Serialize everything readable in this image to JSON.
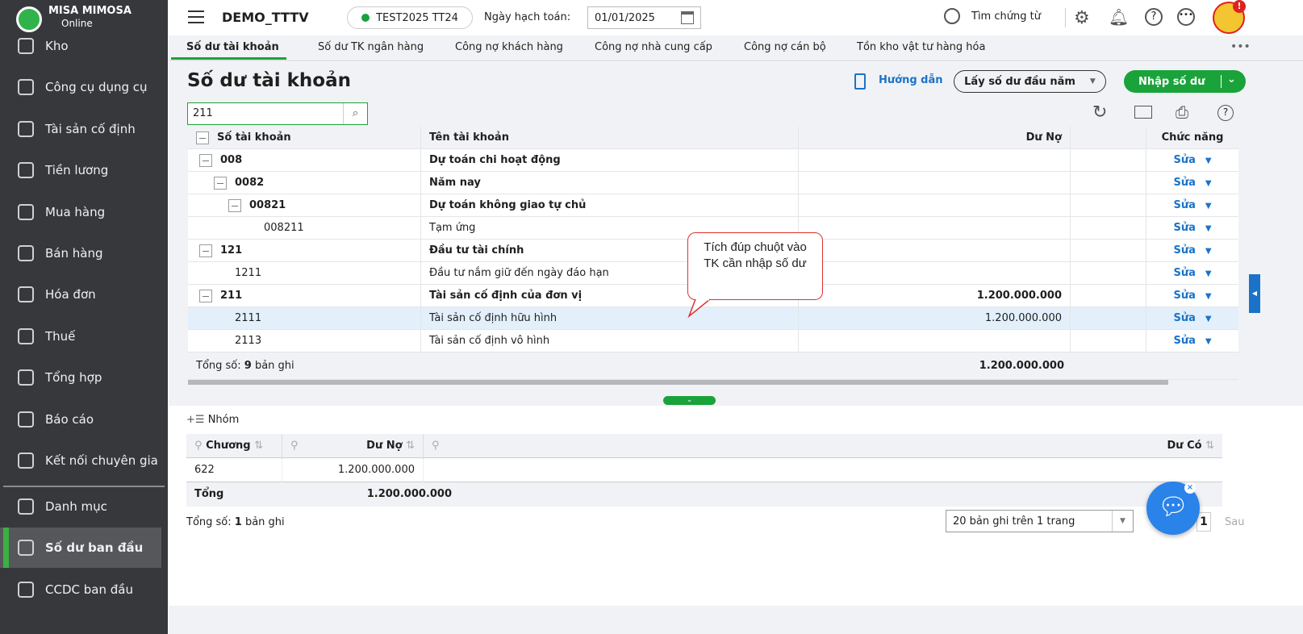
{
  "app": {
    "brand": "MISA MIMOSA",
    "brand_sub": "Online",
    "company": "DEMO_TTTV",
    "dataset": "TEST2025 TT24",
    "date_label": "Ngày hạch toán:",
    "date_value": "01/01/2025",
    "search_label": "Tìm chứng từ",
    "dataset_status_color": "#19a33a"
  },
  "sidebar": {
    "items": [
      {
        "label": "Kho",
        "icon": "warehouse-icon"
      },
      {
        "label": "Công cụ dụng cụ",
        "icon": "tools-icon"
      },
      {
        "label": "Tài sản cố định",
        "icon": "car-icon"
      },
      {
        "label": "Tiền lương",
        "icon": "wallet-icon"
      },
      {
        "label": "Mua hàng",
        "icon": "bag-icon"
      },
      {
        "label": "Bán hàng",
        "icon": "cart-icon"
      },
      {
        "label": "Hóa đơn",
        "icon": "invoice-icon"
      },
      {
        "label": "Thuế",
        "icon": "tax-icon"
      },
      {
        "label": "Tổng hợp",
        "icon": "ledger-icon"
      },
      {
        "label": "Báo cáo",
        "icon": "report-icon"
      },
      {
        "label": "Kết nối chuyên gia",
        "icon": "expert-icon"
      },
      {
        "label": "Danh mục",
        "icon": "list-icon"
      },
      {
        "label": "Số dư ban đầu",
        "icon": "balance-file-icon",
        "active": true
      },
      {
        "label": "CCDC ban đầu",
        "icon": "tool-file-icon"
      }
    ]
  },
  "tabs": [
    "Số dư tài khoản",
    "Số dư TK ngân hàng",
    "Công nợ khách hàng",
    "Công nợ nhà cung cấp",
    "Công nợ cán bộ",
    "Tồn kho vật tư hàng hóa"
  ],
  "page": {
    "title": "Số dư tài khoản",
    "guide": "Hướng dẫn",
    "fetch": "Lấy số dư đầu năm",
    "primary": "Nhập số dư",
    "search_value": "211"
  },
  "grid": {
    "headers": [
      "Số tài khoản",
      "Tên tài khoản",
      "Dư Nợ",
      "",
      "Chức năng"
    ],
    "rows": [
      {
        "code": "008",
        "name": "Dự toán chi hoạt động",
        "debit": "",
        "level": 0,
        "bold": true,
        "group": true
      },
      {
        "code": "0082",
        "name": "Năm nay",
        "debit": "",
        "level": 1,
        "bold": true,
        "group": true
      },
      {
        "code": "00821",
        "name": "Dự toán không giao tự chủ",
        "debit": "",
        "level": 2,
        "bold": true,
        "group": true
      },
      {
        "code": "008211",
        "name": "Tạm ứng",
        "debit": "",
        "level": 3
      },
      {
        "code": "121",
        "name": "Đầu tư tài chính",
        "debit": "",
        "level": 0,
        "bold": true,
        "group": true
      },
      {
        "code": "1211",
        "name": "Đầu tư nắm giữ đến ngày đáo hạn",
        "debit": "",
        "level": 1
      },
      {
        "code": "211",
        "name": "Tài sản cố định của đơn vị",
        "debit": "1.200.000.000",
        "level": 0,
        "bold": true,
        "group": true
      },
      {
        "code": "2111",
        "name": "Tài sản cố định hữu hình",
        "debit": "1.200.000.000",
        "level": 1,
        "selected": true
      },
      {
        "code": "2113",
        "name": "Tài sản cố định vô hình",
        "debit": "",
        "level": 1
      }
    ],
    "action": "Sửa",
    "footer_prefix": "Tổng số:",
    "footer_count": "9",
    "footer_suffix": "bản ghi",
    "footer_total": "1.200.000.000"
  },
  "callout": "Tích đúp chuột vào TK cần nhập số dư",
  "detail": {
    "group_label": "Nhóm",
    "headers": [
      "Chương",
      "Dư Nợ",
      "Dư Có"
    ],
    "rows": [
      {
        "chapter": "622",
        "debit": "1.200.000.000",
        "credit": ""
      }
    ],
    "total_label": "Tổng",
    "total_debit": "1.200.000.000",
    "footer_prefix": "Tổng số:",
    "footer_count": "1",
    "footer_suffix": "bản ghi",
    "page_size": "20 bản ghi trên 1 trang",
    "page": "1",
    "next": "Sau"
  }
}
